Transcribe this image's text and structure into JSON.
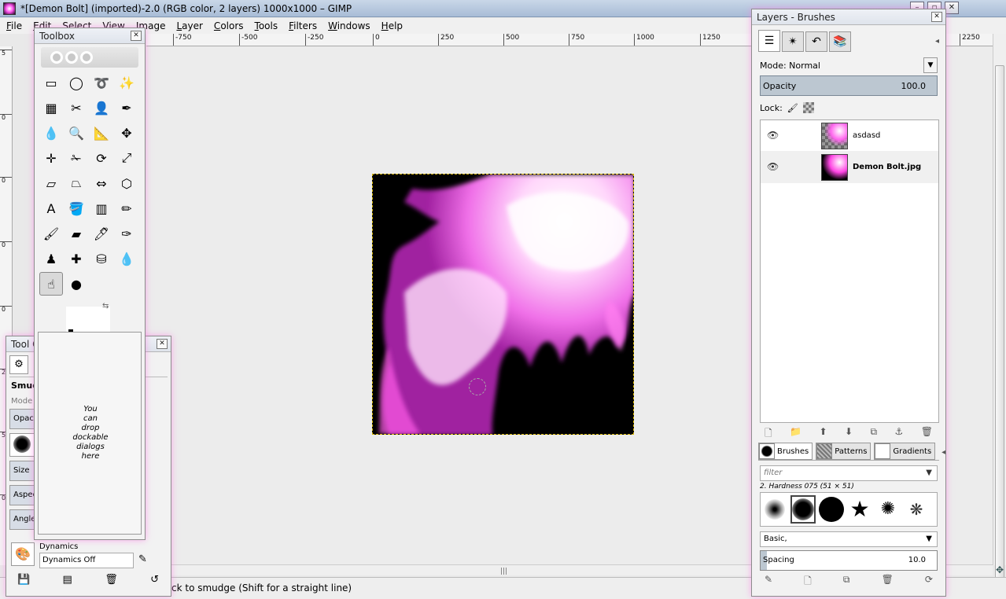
{
  "window": {
    "title": "*[Demon Bolt] (imported)-2.0 (RGB color, 2 layers) 1000x1000 – GIMP"
  },
  "menu": [
    "File",
    "Edit",
    "Select",
    "View",
    "Image",
    "Layer",
    "Colors",
    "Tools",
    "Filters",
    "Windows",
    "Help"
  ],
  "ruler_top": [
    "-750",
    "-500",
    "-250",
    "0",
    "250",
    "500",
    "750",
    "1000",
    "1250",
    "2250"
  ],
  "ruler_left": [
    "5",
    "0",
    "0",
    "0",
    "0",
    "2",
    "5",
    "0"
  ],
  "toolbox": {
    "title": "Toolbox",
    "drop_text": [
      "You",
      "can",
      "drop",
      "dockable",
      "dialogs",
      "here"
    ]
  },
  "tool_options": {
    "title": "Tool O",
    "tool_name": "Smudg",
    "rows": [
      "Mode",
      "Opac",
      "",
      "Size",
      "Aspec",
      "Angle"
    ],
    "dynamics_label": "Dynamics",
    "dynamics_value": "Dynamics Off"
  },
  "layers": {
    "title": "Layers - Brushes",
    "mode_label": "Mode: Normal",
    "opacity_label": "Opacity",
    "opacity_value": "100.0",
    "lock_label": "Lock:",
    "items": [
      {
        "name": "asdasd",
        "selected": false
      },
      {
        "name": "Demon Bolt.jpg",
        "selected": true
      }
    ]
  },
  "brushes": {
    "tabs": [
      "Brushes",
      "Patterns",
      "Gradients"
    ],
    "filter_placeholder": "filter",
    "brush_name": "2. Hardness 075 (51 × 51)",
    "preset": "Basic,",
    "spacing_label": "Spacing",
    "spacing_value": "10.0"
  },
  "status": {
    "text": "ck to smudge (Shift for a straight line)"
  }
}
